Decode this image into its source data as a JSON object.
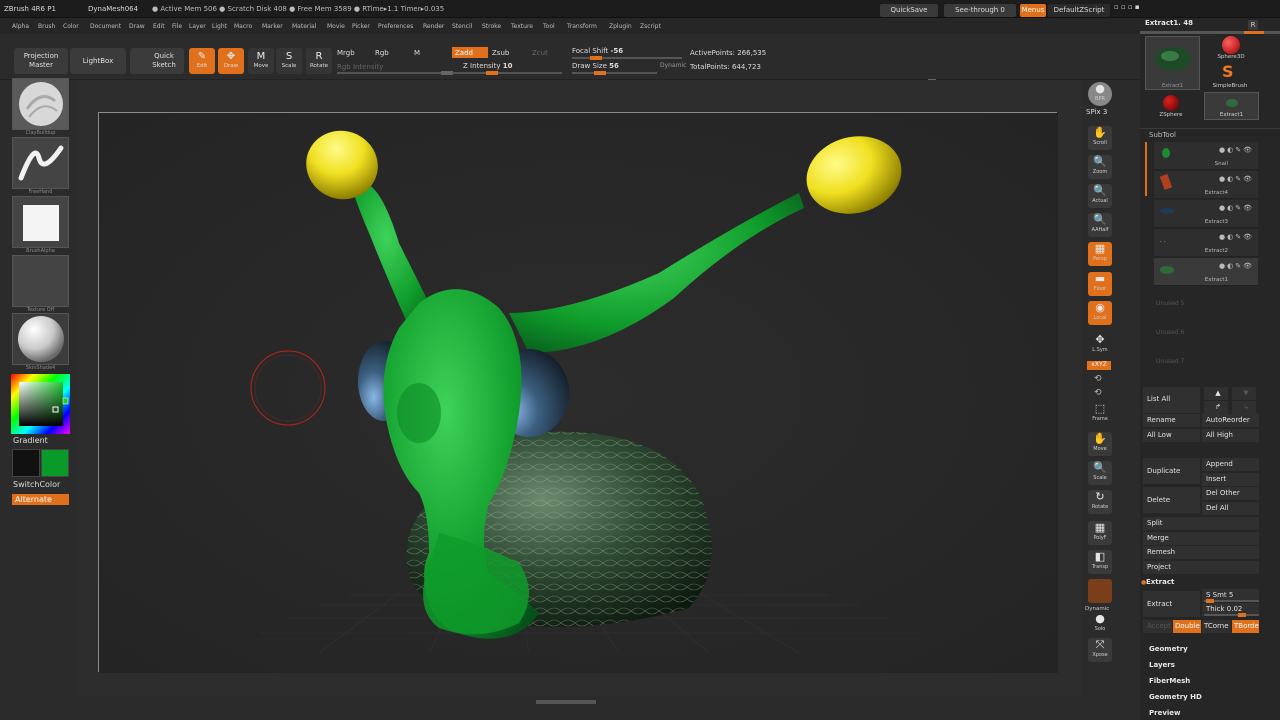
{
  "titlebar": {
    "app": "ZBrush 4R6 P1",
    "doc": "DynaMesh064",
    "mem": "● Active Mem 506  ● Scratch Disk 408  ● Free Mem 3589  ● RTime▸1.1  Timer▸0.035",
    "quicksave": "QuickSave",
    "seethrough": "See-through  0",
    "menus": "Menus",
    "script": "DefaultZScript"
  },
  "menus": [
    "Alpha",
    "Brush",
    "Color",
    "Document",
    "Draw",
    "Edit",
    "File",
    "Layer",
    "Light",
    "Macro",
    "Marker",
    "Material",
    "Movie",
    "Picker",
    "Preferences",
    "Render",
    "Stencil",
    "Stroke",
    "Texture",
    "Tool",
    "Transform",
    "Zplugin",
    "Zscript"
  ],
  "toolbar": {
    "projection_master": "Projection Master",
    "lightbox": "LightBox",
    "quick_sketch": "Quick Sketch",
    "edit": "Edit",
    "draw": "Draw",
    "move": "Move",
    "scale": "Scale",
    "rotate": "Rotate",
    "mrgb": "Mrgb",
    "rgb": "Rgb",
    "m": "M",
    "rgb_intensity": "Rgb Intensity",
    "zadd": "Zadd",
    "zsub": "Zsub",
    "zcut": "Zcut",
    "z_intensity": "Z Intensity",
    "z_intensity_val": "10",
    "focal_shift": "Focal Shift",
    "focal_shift_val": "-56",
    "draw_size": "Draw Size",
    "draw_size_val": "56",
    "dynamic": "Dynamic",
    "active_points": "ActivePoints: 266,535",
    "total_points": "TotalPoints: 644,723"
  },
  "leftshelf": {
    "brush": "ClayBuildup",
    "stroke": "FreeHand",
    "alpha": "BrushAlpha",
    "texture": "Texture Off",
    "material": "SkinShade4",
    "gradient": "Gradient",
    "switchcolor": "SwitchColor",
    "alternate": "Alternate",
    "colors": {
      "main": "#1a1a1a",
      "secondary": "#0a9a2a"
    }
  },
  "rightshelf": [
    {
      "name": "bpr",
      "icon": "●",
      "label": "BPR"
    },
    {
      "name": "spix",
      "icon": "",
      "label": "SPix 3"
    },
    {
      "name": "scroll",
      "icon": "✋",
      "label": "Scroll"
    },
    {
      "name": "zoom",
      "icon": "🔍",
      "label": "Zoom"
    },
    {
      "name": "actual",
      "icon": "🔍",
      "label": "Actual"
    },
    {
      "name": "aahalf",
      "icon": "🔍",
      "label": "AAHalf"
    },
    {
      "name": "persp",
      "icon": "▦",
      "label": "Persp"
    },
    {
      "name": "floor",
      "icon": "▬",
      "label": "Floor"
    },
    {
      "name": "local",
      "icon": "◉",
      "label": "Local"
    },
    {
      "name": "lsym",
      "icon": "✥",
      "label": "L.Sym"
    },
    {
      "name": "xyz",
      "icon": "",
      "label": "xXYZ"
    },
    {
      "name": "frame",
      "icon": "⬚",
      "label": "Frame"
    },
    {
      "name": "move",
      "icon": "✋",
      "label": "Move"
    },
    {
      "name": "scale",
      "icon": "🔍",
      "label": "Scale"
    },
    {
      "name": "rotate",
      "icon": "↻",
      "label": "Rotate"
    },
    {
      "name": "polyf",
      "icon": "▦",
      "label": "PolyF"
    },
    {
      "name": "transp",
      "icon": "◧",
      "label": "Transp"
    },
    {
      "name": "dynamic",
      "icon": "",
      "label": "Dynamic"
    },
    {
      "name": "solo",
      "icon": "●",
      "label": "Solo"
    },
    {
      "name": "xpose",
      "icon": "⤧",
      "label": "Xpose"
    }
  ],
  "panel": {
    "tool_name": "Extract1. 48",
    "r": "R",
    "tools": [
      "Extract1",
      "Sphere3D",
      "SimpleBrush",
      "ZSphere",
      "Extract1"
    ],
    "subtool_title": "SubTool",
    "subtools": [
      "Snail",
      "Extract4",
      "Extract3",
      "Extract2",
      "Extract1"
    ],
    "unused": [
      "Unused 5",
      "Unused 6",
      "Unused 7"
    ],
    "list_all": "List All",
    "rename": "Rename",
    "autoreorder": "AutoReorder",
    "all_low": "All Low",
    "all_high": "All High",
    "duplicate": "Duplicate",
    "append": "Append",
    "insert": "Insert",
    "delete": "Delete",
    "del_other": "Del Other",
    "del_all": "Del All",
    "split": "Split",
    "merge": "Merge",
    "remesh": "Remesh",
    "project": "Project",
    "extract_title": "Extract",
    "extract_btn": "Extract",
    "smt": "S Smt 5",
    "thick": "Thick 0.02",
    "accept": "Accept",
    "double": "Double",
    "tcorner": "TCorne",
    "tborder": "TBorde",
    "sections": [
      "Geometry",
      "Layers",
      "FiberMesh",
      "Geometry HD",
      "Preview"
    ]
  }
}
